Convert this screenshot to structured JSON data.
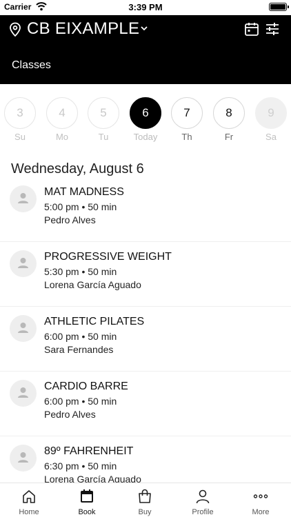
{
  "status": {
    "carrier": "Carrier",
    "time": "3:39 PM"
  },
  "header": {
    "location": "CB EIXAMPLE",
    "subtitle": "Classes"
  },
  "days": [
    {
      "num": "3",
      "label": "Su",
      "state": "past"
    },
    {
      "num": "4",
      "label": "Mo",
      "state": "past"
    },
    {
      "num": "5",
      "label": "Tu",
      "state": "past"
    },
    {
      "num": "6",
      "label": "Today",
      "state": "selected"
    },
    {
      "num": "7",
      "label": "Th",
      "state": "active"
    },
    {
      "num": "8",
      "label": "Fr",
      "state": "active"
    },
    {
      "num": "9",
      "label": "Sa",
      "state": "disabled"
    }
  ],
  "date_heading": "Wednesday, August 6",
  "classes": [
    {
      "name": "MAT MADNESS",
      "when": "5:00 pm • 50 min",
      "instructor": "Pedro Alves"
    },
    {
      "name": "PROGRESSIVE WEIGHT",
      "when": "5:30 pm • 50 min",
      "instructor": "Lorena García Aguado"
    },
    {
      "name": "ATHLETIC PILATES",
      "when": "6:00 pm • 50 min",
      "instructor": "Sara Fernandes"
    },
    {
      "name": "CARDIO BARRE",
      "when": "6:00 pm • 50 min",
      "instructor": "Pedro Alves"
    },
    {
      "name": "89º FAHRENHEIT",
      "when": "6:30 pm • 50 min",
      "instructor": "Lorena García Aguado"
    }
  ],
  "tabs": [
    {
      "label": "Home",
      "icon": "home-icon"
    },
    {
      "label": "Book",
      "icon": "calendar-icon",
      "active": true
    },
    {
      "label": "Buy",
      "icon": "shopping-bag-icon"
    },
    {
      "label": "Profile",
      "icon": "person-icon"
    },
    {
      "label": "More",
      "icon": "more-icon"
    }
  ]
}
